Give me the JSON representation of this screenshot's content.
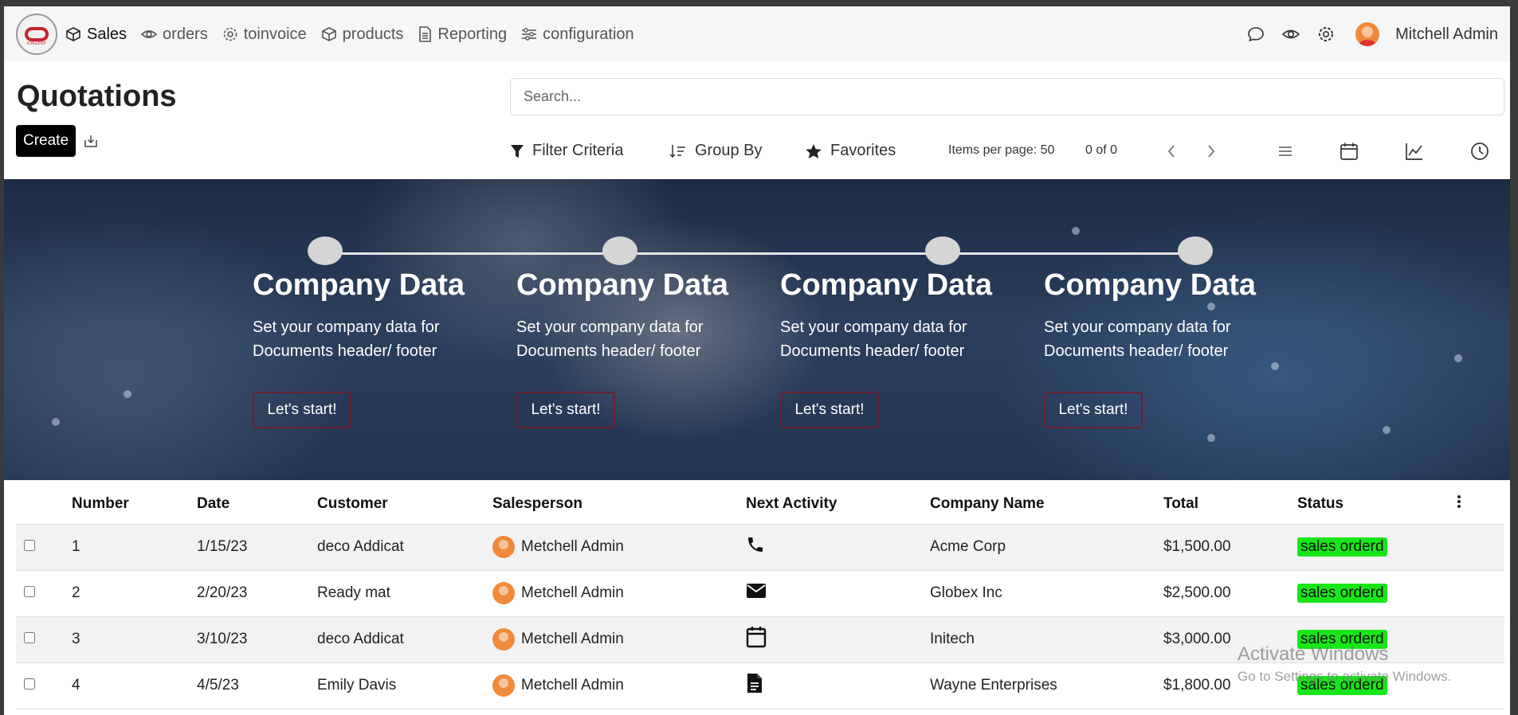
{
  "nav": {
    "logo_text": "KINGERP",
    "items": [
      {
        "label": "Sales",
        "icon": "box-icon"
      },
      {
        "label": "orders",
        "icon": "eye-icon"
      },
      {
        "label": "toinvoice",
        "icon": "gear-icon"
      },
      {
        "label": "products",
        "icon": "box-icon"
      },
      {
        "label": "Reporting",
        "icon": "document-icon"
      },
      {
        "label": "configuration",
        "icon": "sliders-icon"
      }
    ],
    "user_name": "Mitchell Admin"
  },
  "page": {
    "title": "Quotations",
    "create_label": "Create"
  },
  "search": {
    "placeholder": "Search..."
  },
  "controls": {
    "filter_label": "Filter Criteria",
    "group_label": "Group By",
    "favorites_label": "Favorites",
    "items_per_page": "Items per page: 50",
    "pager": "0 of 0"
  },
  "banner": {
    "steps": [
      {
        "title": "Company Data",
        "desc": "Set your company data for Documents header/ footer",
        "button": "Let's start!"
      },
      {
        "title": "Company Data",
        "desc": "Set your company data for Documents header/ footer",
        "button": "Let's start!"
      },
      {
        "title": "Company Data",
        "desc": "Set your company data for Documents header/ footer",
        "button": "Let's start!"
      },
      {
        "title": "Company Data",
        "desc": "Set your company data for Documents header/ footer",
        "button": "Let's start!"
      }
    ]
  },
  "table": {
    "headers": [
      "Number",
      "Date",
      "Customer",
      "Salesperson",
      "Next Activity",
      "Company Name",
      "Total",
      "Status"
    ],
    "rows": [
      {
        "number": "1",
        "date": "1/15/23",
        "customer": "deco Addicat",
        "salesperson": "Metchell Admin",
        "activity": "phone-icon",
        "company": "Acme Corp",
        "total": "$1,500.00",
        "status": "sales orderd"
      },
      {
        "number": "2",
        "date": "2/20/23",
        "customer": "Ready mat",
        "salesperson": "Metchell Admin",
        "activity": "envelope-icon",
        "company": "Globex Inc",
        "total": "$2,500.00",
        "status": "sales orderd"
      },
      {
        "number": "3",
        "date": "3/10/23",
        "customer": "deco Addicat",
        "salesperson": "Metchell Admin",
        "activity": "calendar-icon",
        "company": "Initech",
        "total": "$3,000.00",
        "status": "sales orderd"
      },
      {
        "number": "4",
        "date": "4/5/23",
        "customer": "Emily Davis",
        "salesperson": "Metchell Admin",
        "activity": "document-icon",
        "company": "Wayne Enterprises",
        "total": "$1,800.00",
        "status": "sales orderd"
      }
    ]
  },
  "watermark": {
    "line1": "Activate Windows",
    "line2": "Go to Settings to activate Windows."
  },
  "colors": {
    "status_green": "#19e619",
    "create_button": "#000000",
    "nav_background": "#f5f6f8"
  }
}
